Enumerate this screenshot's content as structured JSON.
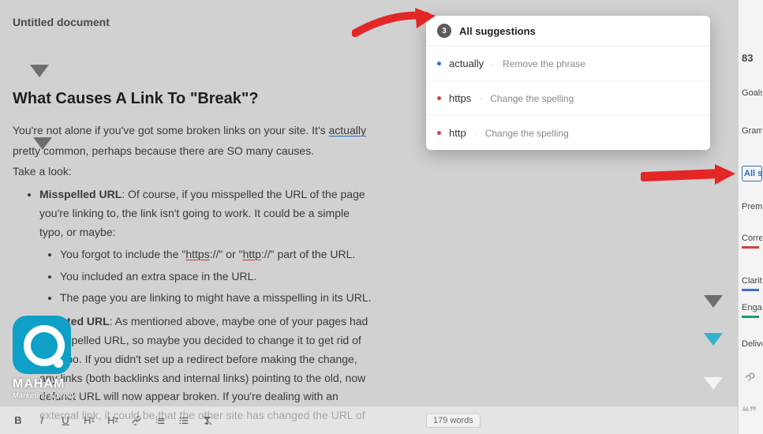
{
  "doc": {
    "title": "Untitled document",
    "heading": "What Causes A Link To \"Break\"?",
    "p1a": "You're not alone if you've got some broken links on your site. It's ",
    "p1b": "actually",
    "p2": "pretty common, perhaps because there are SO many causes.",
    "p3": "Take a look:",
    "li1_b": "Misspelled URL",
    "li1": ": Of course, if you misspelled the URL of the page you're linking to, the link isn't going to work. It could be a simple typo, or maybe:",
    "li1a_a": "You forgot to include the \"",
    "li1a_h": "https",
    "li1a_m": "://\" or \"",
    "li1a_h2": "http",
    "li1a_e": "://\" part of the URL.",
    "li1b": "You included an extra space in the URL.",
    "li1c": "The page you are linking to might have a misspelling in its URL.",
    "li2_b": "Updated URL",
    "li2": ": As mentioned above, maybe one of your pages had a misspelled URL, so maybe you decided to change it to get rid of the typo. If you didn't set up a redirect before making the change, any links (both backlinks and internal links) pointing to the old, now defunct URL will now appear broken. If you're dealing with an external link, it could be that the other site has changed the URL of"
  },
  "toolbar": {
    "wordcount": "179 words"
  },
  "popover": {
    "count": "3",
    "title": "All suggestions",
    "items": [
      {
        "word": "actually",
        "desc": "Remove the phrase",
        "kind": "blue"
      },
      {
        "word": "https",
        "desc": "Change the spelling",
        "kind": "red"
      },
      {
        "word": "http",
        "desc": "Change the spelling",
        "kind": "red"
      }
    ]
  },
  "rail": {
    "score": "83",
    "goals": "Goals",
    "grammar": "Grammar",
    "all": "All suggestions",
    "premium": "Premium",
    "correctness": "Correctness",
    "clarity": "Clarity",
    "engagement": "Engagement",
    "delivery": "Delivery"
  },
  "logo": {
    "name": "MAHAM",
    "sub": "Marketing Agency"
  }
}
